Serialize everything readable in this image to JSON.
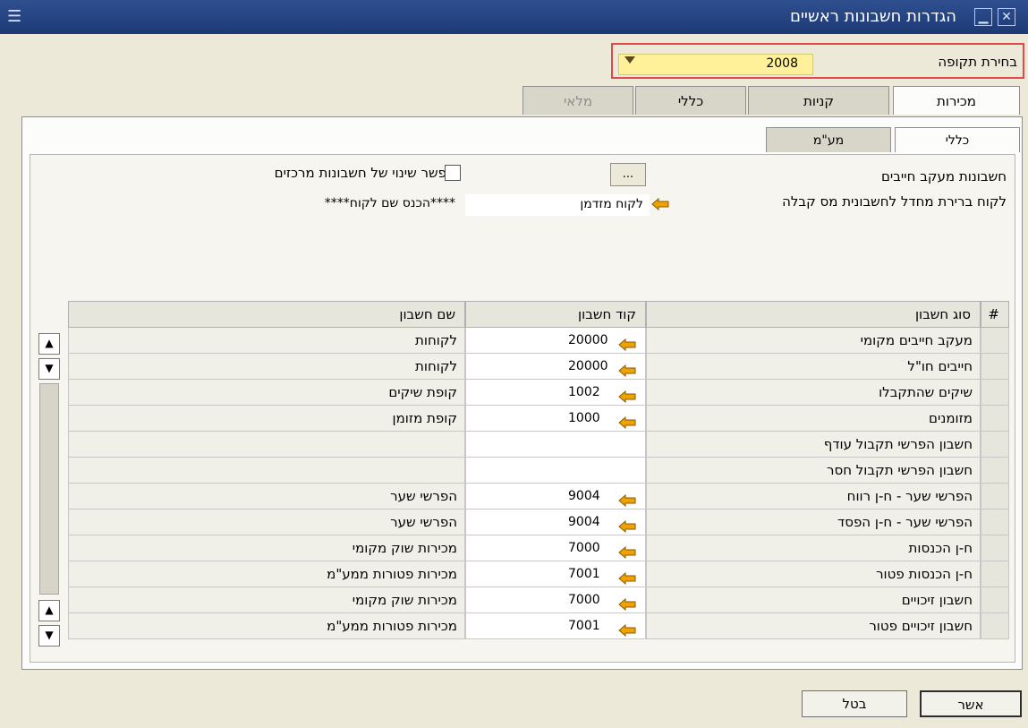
{
  "window": {
    "title": "הגדרות חשבונות ראשיים"
  },
  "period": {
    "label": "בחירת תקופה",
    "value": "2008"
  },
  "tabs": [
    {
      "label": "מכירות"
    },
    {
      "label": "קניות"
    },
    {
      "label": "כללי"
    },
    {
      "label": "מלאי"
    }
  ],
  "subtabs": [
    {
      "label": "כללי"
    },
    {
      "label": "מע\"מ"
    }
  ],
  "form": {
    "debtor_label": "חשבונות מעקב חייבים",
    "customer_label": "לקוח ברירת מחדל לחשבונית מס קבלה",
    "customer_value": "לקוח מזדמן",
    "customer_placeholder": "****הכנס שם לקוח****",
    "checkbox_label": "אפשר שינוי של חשבונות מרכזים",
    "dots_button": "..."
  },
  "grid": {
    "headers": {
      "hash": "#",
      "type": "סוג חשבון",
      "code": "קוד חשבון",
      "name": "שם חשבון"
    },
    "rows": [
      {
        "type": "מעקב חייבים מקומי",
        "code": "20000",
        "name": "לקוחות"
      },
      {
        "type": "חייבים חו\"ל",
        "code": "20000",
        "name": "לקוחות"
      },
      {
        "type": "שיקים שהתקבלו",
        "code": "1002",
        "name": "קופת שיקים"
      },
      {
        "type": "מזומנים",
        "code": "1000",
        "name": "קופת מזומן"
      },
      {
        "type": "חשבון הפרשי תקבול עודף",
        "code": "",
        "name": ""
      },
      {
        "type": "חשבון הפרשי תקבול חסר",
        "code": "",
        "name": ""
      },
      {
        "type": "הפרשי שער - ח-ן רווח",
        "code": "9004",
        "name": "הפרשי שער"
      },
      {
        "type": "הפרשי שער - ח-ן הפסד",
        "code": "9004",
        "name": "הפרשי שער"
      },
      {
        "type": "ח-ן הכנסות",
        "code": "7000",
        "name": "מכירות שוק מקומי"
      },
      {
        "type": "ח-ן הכנסות פטור",
        "code": "7001",
        "name": "מכירות פטורות ממע\"מ"
      },
      {
        "type": "חשבון זיכויים",
        "code": "7000",
        "name": "מכירות שוק מקומי"
      },
      {
        "type": "חשבון זיכויים פטור",
        "code": "7001",
        "name": "מכירות פטורות ממע\"מ"
      }
    ]
  },
  "buttons": {
    "ok": "אשר",
    "cancel": "בטל"
  },
  "colors": {
    "title_bar": "#1d3a75",
    "period_highlight": "#fff19a",
    "period_border": "#e04a4a",
    "link_arrow": "#f0a300"
  }
}
